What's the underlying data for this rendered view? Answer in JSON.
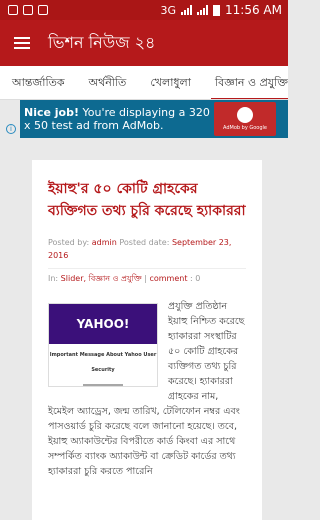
{
  "status_bar": {
    "network": "3G",
    "time": "11:56 AM"
  },
  "app_bar": {
    "title": "ভিশন নিউজ ২৪"
  },
  "tabs": [
    {
      "label": "আন্তর্জাতিক",
      "active": false
    },
    {
      "label": "অর্থনীতি",
      "active": false
    },
    {
      "label": "খেলাধুলা",
      "active": false
    },
    {
      "label": "বিজ্ঞান ও প্রযুক্তি",
      "active": true
    }
  ],
  "ad": {
    "bold_text": "Nice job!",
    "text": " You're displaying a 320 x 50 test ad from AdMob.",
    "logo_caption": "AdMob by Google",
    "info_glyph": "i"
  },
  "article": {
    "title": "ইয়াহু'র ৫০ কোটি গ্রাহকের ব্যক্তিগত তথ্য চুরি করেছে হ্যাকাররা",
    "meta": {
      "posted_by_label": "Posted by: ",
      "author": "admin",
      "posted_date_label": " Posted date: ",
      "date": "September 23, 2016",
      "in_label": "In: ",
      "categories": "Slider, বিজ্ঞান ও প্রযুক্তি",
      "separator": " | ",
      "comment_label": "comment",
      "comment_count": " : 0"
    },
    "image": {
      "logo": "YAHOO!",
      "caption": "Important Message About Yahoo User Security"
    },
    "body": "প্রযুক্তি প্রতিষ্ঠান ইয়াহু নিশ্চিত করেছে হ্যাকাররা সংস্থাটির ৫০ কোটি গ্রাহকের ব্যক্তিগত তথ্য চুরি করেছে। হ্যাকাররা গ্রাহকের নাম, ইমেইল অ্যাড্রেস, জন্ম তারিখ, টেলিফোন নম্বর এবং পাসওয়ার্ড চুরি করেছে বলে জানানো হয়েছে। তবে, ইয়াহু অ্যাকাউন্টের বিপরীতে কার্ড কিংবা এর সাথে সম্পর্কিত ব্যাংক অ্যাকাউন্ট বা ক্রেডিট কার্ডের তথ্য হ্যাকাররা চুরি করতে পারেনি"
  }
}
